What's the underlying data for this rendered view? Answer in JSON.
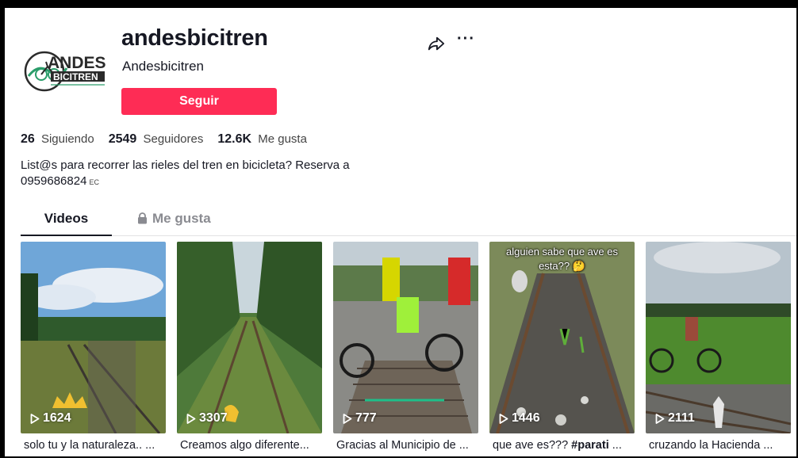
{
  "profile": {
    "username": "andesbicitren",
    "nickname": "Andesbicitren",
    "follow_label": "Seguir",
    "avatar_logo_text": "ANDES BICITREN",
    "stats": [
      {
        "value": "26",
        "label": "Siguiendo"
      },
      {
        "value": "2549",
        "label": "Seguidores"
      },
      {
        "value": "12.6K",
        "label": "Me gusta"
      }
    ],
    "bio_line1": "List@s para recorrer las rieles del tren en bicicleta? Reserva a",
    "bio_line2": "0959686824",
    "bio_region": "EC"
  },
  "tabs": {
    "videos": "Videos",
    "likes": "Me gusta"
  },
  "videos": [
    {
      "views": "1624",
      "caption": "solo tu y la naturaleza.. ...",
      "overlay": ""
    },
    {
      "views": "3307",
      "caption": "Creamos algo diferente...",
      "overlay": ""
    },
    {
      "views": "777",
      "caption": "Gracias al Municipio de ...",
      "overlay": ""
    },
    {
      "views": "1446",
      "caption_plain": "que ave es??? ",
      "caption_bold": "#parati",
      "caption_tail": " ...",
      "overlay": "alguien sabe que ave es esta?? 🤔"
    },
    {
      "views": "2111",
      "caption": "cruzando la Hacienda ...",
      "overlay": ""
    }
  ],
  "colors": {
    "accent": "#fe2c55",
    "text": "#161823",
    "muted": "#8a8b91"
  },
  "icons": [
    "share-icon",
    "more-icon",
    "lock-icon",
    "play-icon"
  ]
}
